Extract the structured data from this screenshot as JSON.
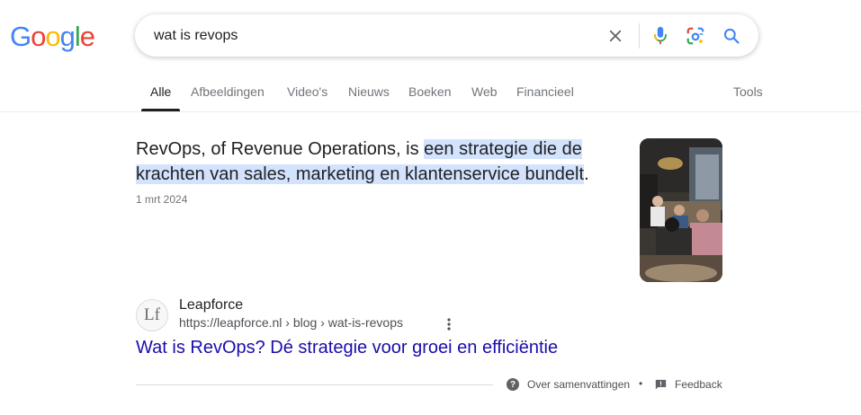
{
  "logo": {
    "letters": [
      "G",
      "o",
      "o",
      "g",
      "l",
      "e"
    ],
    "colors": [
      "#4285f4",
      "#ea4335",
      "#fbbc05",
      "#4285f4",
      "#34a853",
      "#ea4335"
    ]
  },
  "search": {
    "query": "wat is revops"
  },
  "icons": {
    "clear": "close-icon",
    "voice": "microphone-icon",
    "lens": "google-lens-icon",
    "search": "search-icon"
  },
  "tabs": [
    {
      "label": "Alle",
      "active": true
    },
    {
      "label": "Afbeeldingen"
    },
    {
      "label": "Video's"
    },
    {
      "label": "Nieuws"
    },
    {
      "label": "Boeken"
    },
    {
      "label": "Web"
    },
    {
      "label": "Financieel"
    }
  ],
  "tools_label": "Tools",
  "snippet": {
    "prefix": "RevOps, of Revenue Operations, is ",
    "highlight": "een strategie die de krachten van sales, marketing en klantenservice bundelt",
    "suffix": ".",
    "date": "1 mrt 2024",
    "highlight_color": "#d3e3fd"
  },
  "result": {
    "favicon_text": "Lf",
    "site_name": "Leapforce",
    "url": "https://leapforce.nl › blog › wat-is-revops",
    "title": "Wat is RevOps? Dé strategie voor groei en efficiëntie",
    "title_color": "#1a0dab"
  },
  "footer": {
    "about_label": "Over samenvattingen",
    "separator": "•",
    "feedback_label": "Feedback"
  }
}
